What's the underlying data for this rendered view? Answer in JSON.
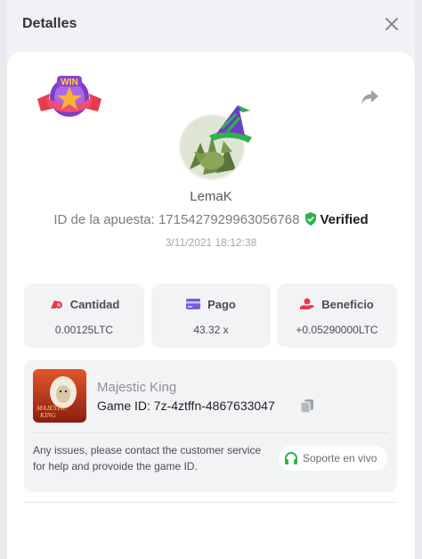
{
  "header": {
    "title": "Detalles"
  },
  "user": {
    "username": "LemaK"
  },
  "bet": {
    "id_label": "ID de la apuesta:",
    "id_value": "1715427929963056768",
    "verified_label": "Verified",
    "datetime": "3/11/2021 18:12:38"
  },
  "stats": [
    {
      "label": "Cantidad",
      "value": "0.00125LTC",
      "icon": "coins-icon"
    },
    {
      "label": "Pago",
      "value": "43.32 x",
      "icon": "card-icon"
    },
    {
      "label": "Beneficio",
      "value": "+0.05290000LTC",
      "icon": "hand-coin-icon"
    }
  ],
  "game": {
    "name": "Majestic King",
    "game_id": "Game ID: 7z-4ztffn-4867633047",
    "thumb_text_1": "MAJESTIC",
    "thumb_text_2": "KING"
  },
  "support": {
    "note": "Any issues, please contact the customer service for help and provoide the game ID.",
    "button_label": "Soporte en vivo"
  },
  "badge": {
    "text": "WIN"
  },
  "colors": {
    "verified": "#2db34a",
    "accent_red": "#e8394f",
    "accent_purple": "#7b5bd6"
  }
}
